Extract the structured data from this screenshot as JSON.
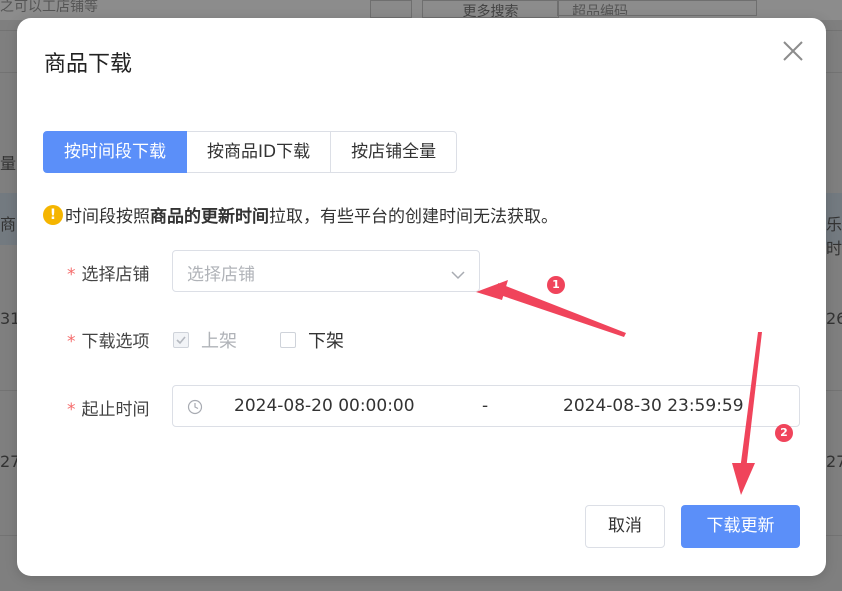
{
  "background": {
    "search_placeholder": "之可以工店铺等",
    "button_more": "更多搜索",
    "input_placeholder": "超品编码",
    "left_labels": [
      "量",
      "商",
      "31",
      "27"
    ],
    "right_labels": [
      "乐时",
      "26",
      "27"
    ]
  },
  "modal": {
    "title": "商品下载",
    "close_icon": "close-icon",
    "tabs": [
      {
        "label": "按时间段下载",
        "active": true
      },
      {
        "label": "按商品ID下载",
        "active": false
      },
      {
        "label": "按店铺全量",
        "active": false
      }
    ],
    "notice": {
      "icon": "warning-icon",
      "prefix": "时间段按照",
      "bold": "商品的更新时间",
      "suffix": "拉取，有些平台的创建时间无法获取。"
    },
    "form": {
      "required_mark": "*",
      "store": {
        "label": "选择店铺",
        "placeholder": "选择店铺"
      },
      "options": {
        "label": "下载选项",
        "items": [
          {
            "label": "上架",
            "checked": true,
            "disabled": true
          },
          {
            "label": "下架",
            "checked": false,
            "disabled": false
          }
        ]
      },
      "time": {
        "label": "起止时间",
        "start": "2024-08-20 00:00:00",
        "separator": "-",
        "end": "2024-08-30 23:59:59"
      }
    },
    "buttons": {
      "cancel": "取消",
      "confirm": "下载更新"
    }
  },
  "annotations": [
    "1",
    "2"
  ],
  "colors": {
    "primary": "#5b8ff9",
    "required": "#f56c6c",
    "warning": "#f5b500",
    "annotation": "#f0445b",
    "overlay": "#7f7f7f"
  }
}
